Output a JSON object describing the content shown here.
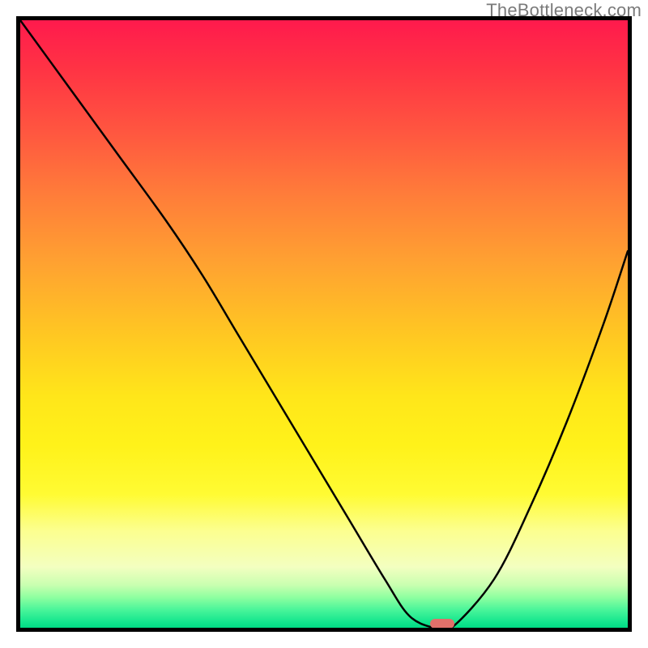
{
  "watermark": "TheBottleneck.com",
  "chart_data": {
    "type": "line",
    "title": "",
    "xlabel": "",
    "ylabel": "",
    "xlim": [
      0,
      100
    ],
    "ylim": [
      0,
      100
    ],
    "grid": false,
    "legend": false,
    "background_gradient": {
      "top": "#ff1a4d",
      "mid": "#ffe61a",
      "bottom": "#00db85"
    },
    "series": [
      {
        "name": "bottleneck-curve",
        "color": "#000000",
        "x": [
          0,
          8,
          16,
          24,
          30,
          36,
          42,
          48,
          54,
          60,
          64,
          68,
          71,
          78,
          84,
          90,
          96,
          100
        ],
        "values": [
          100,
          89,
          78,
          67,
          58,
          48,
          38,
          28,
          18,
          8,
          2,
          0,
          0,
          8,
          20,
          34,
          50,
          62
        ]
      }
    ],
    "marker": {
      "name": "optimal-point",
      "x": 69.5,
      "y": 0,
      "color": "#e0706a"
    }
  }
}
